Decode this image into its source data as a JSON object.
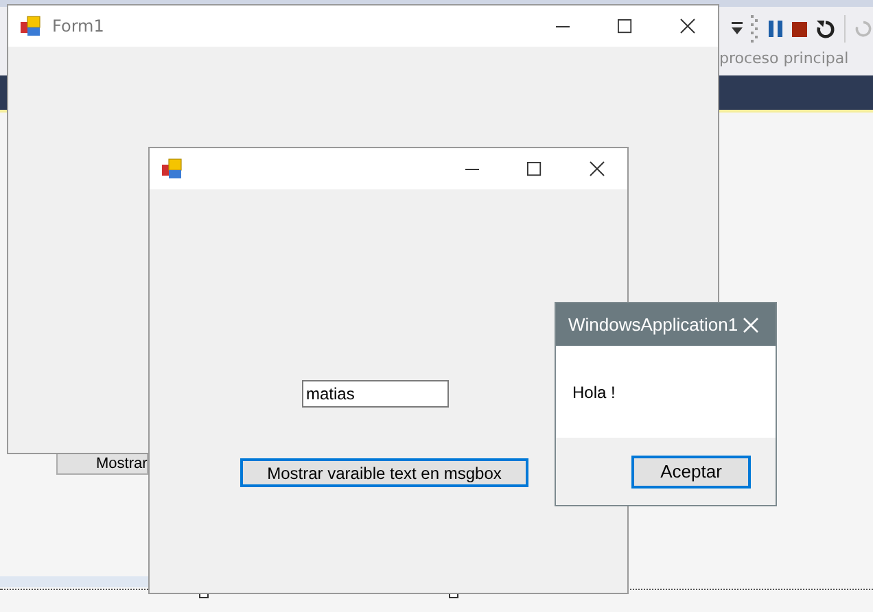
{
  "ide": {
    "process_label": "proceso principal",
    "designer_button": "Mostrar"
  },
  "form1": {
    "title": "Form1"
  },
  "form2": {
    "textbox_value": "matias",
    "button": "Mostrar varaible text en msgbox"
  },
  "msgbox": {
    "title": "WindowsApplication1",
    "message": "Hola !",
    "button": "Aceptar"
  }
}
